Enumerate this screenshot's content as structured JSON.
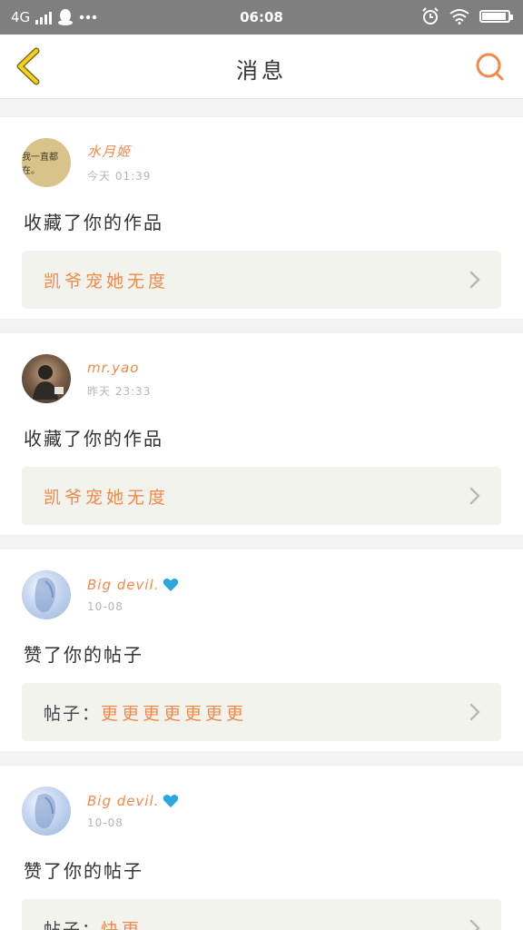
{
  "status_bar": {
    "network": "4G",
    "time": "06:08",
    "icons": [
      "signal-icon",
      "qq-icon",
      "more-icon",
      "alarm-icon",
      "wifi-icon",
      "battery-icon"
    ]
  },
  "header": {
    "title": "消息",
    "back_icon": "back-chevron-icon",
    "search_icon": "search-icon"
  },
  "colors": {
    "accent": "#f08a4b",
    "back_icon": "#f2d21a",
    "heart": "#2aa6e0"
  },
  "messages": [
    {
      "username": "水月姬",
      "time": "今天 01:39",
      "avatar_text": "我一直都在。",
      "action": "收藏了你的作品",
      "target_prefix": "",
      "target_name": "凯爷宠她无度"
    },
    {
      "username": "mr.yao",
      "time": "昨天 23:33",
      "action": "收藏了你的作品",
      "target_prefix": "",
      "target_name": "凯爷宠她无度"
    },
    {
      "username": "Big devil.",
      "time": "10-08",
      "action": "赞了你的帖子",
      "target_prefix": "帖子：",
      "target_name": "更更更更更更更"
    },
    {
      "username": "Big devil.",
      "time": "10-08",
      "action": "赞了你的帖子",
      "target_prefix": "帖子：",
      "target_name": "快更"
    }
  ]
}
